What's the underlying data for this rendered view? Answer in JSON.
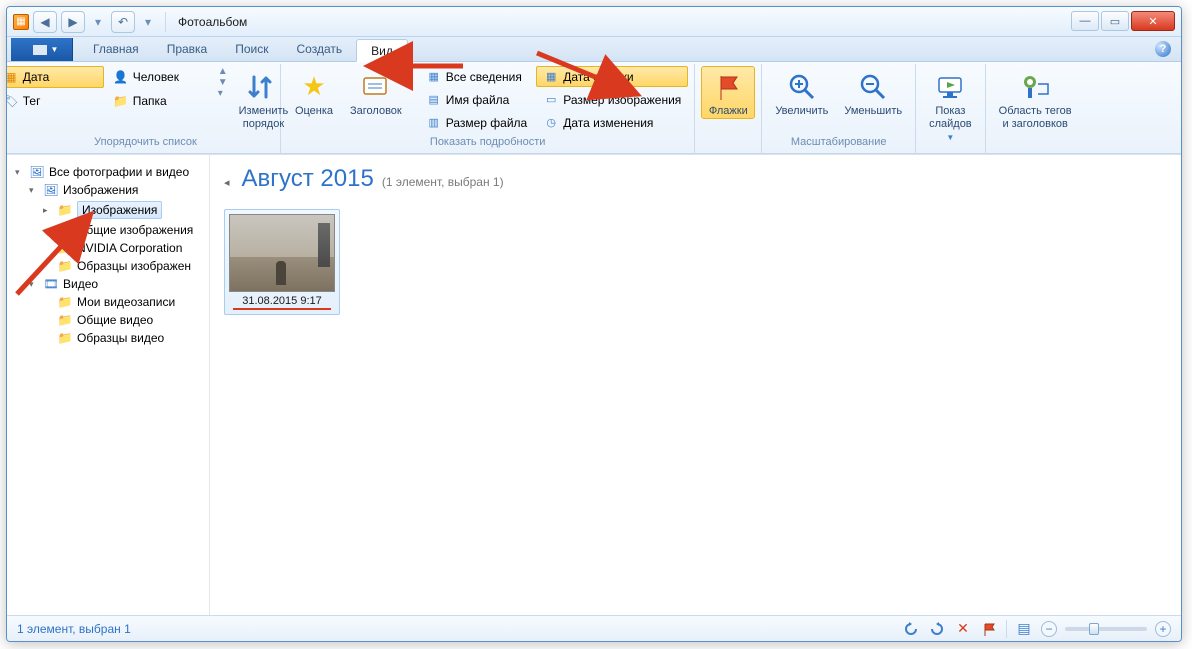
{
  "window": {
    "title": "Фотоальбом"
  },
  "tabs": {
    "main": "Главная",
    "edit": "Правка",
    "search": "Поиск",
    "create": "Создать",
    "view": "Вид"
  },
  "ribbon": {
    "arrange": {
      "date": "Дата",
      "tag": "Тег",
      "person": "Человек",
      "folder": "Папка",
      "reverse": "Изменить\nпорядок",
      "group_label": "Упорядочить список"
    },
    "rating": "Оценка",
    "caption": "Заголовок",
    "details": {
      "all": "Все сведения",
      "filename": "Имя файла",
      "filesize": "Размер файла",
      "date_taken": "Дата съемки",
      "image_size": "Размер изображения",
      "date_modified": "Дата изменения",
      "group_label": "Показать подробности"
    },
    "flags": "Флажки",
    "zoom_in": "Увеличить",
    "zoom_out": "Уменьшить",
    "slideshow": "Показ\nслайдов",
    "tag_area": "Область тегов\nи заголовков",
    "scale_group": "Масштабирование"
  },
  "tree": {
    "root": "Все фотографии и видео",
    "images": "Изображения",
    "images_sub": "Изображения",
    "shared_images": "Общие изображения",
    "nvidia": "NVIDIA Corporation",
    "sample_images": "Образцы изображен",
    "video": "Видео",
    "my_videos": "Мои видеозаписи",
    "shared_video": "Общие видео",
    "sample_video": "Образцы видео"
  },
  "content": {
    "group_title": "Август 2015",
    "group_sub": "(1 элемент, выбран 1)",
    "thumb_label": "31.08.2015 9:17"
  },
  "status": {
    "text": "1 элемент, выбран 1"
  }
}
